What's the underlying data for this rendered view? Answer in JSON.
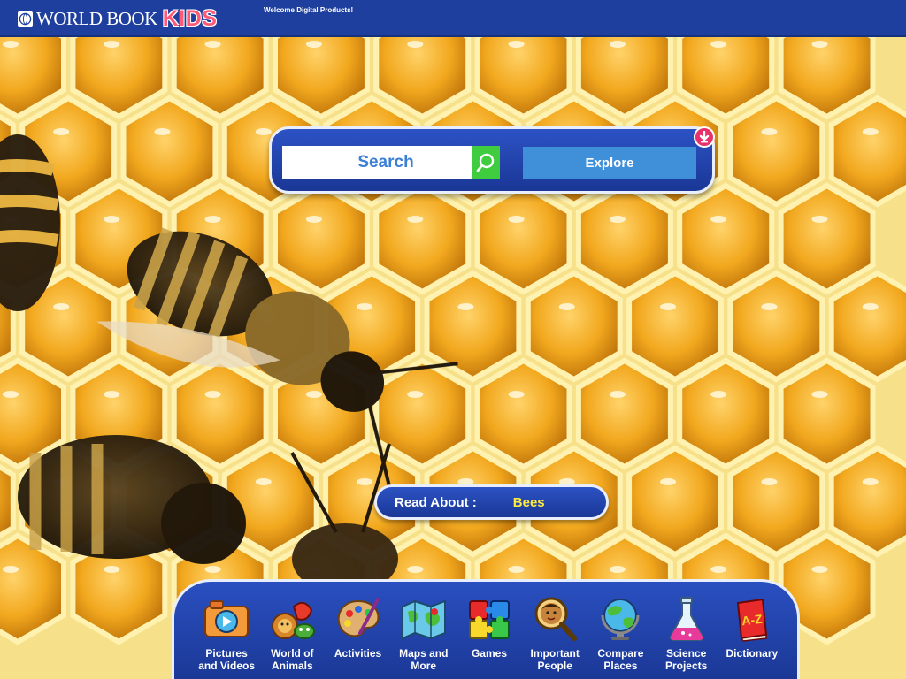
{
  "header": {
    "logo_text": "WORLD BOOK",
    "logo_kids": "KIDS",
    "welcome": "Welcome Digital Products!"
  },
  "search": {
    "placeholder": "Search",
    "explore_label": "Explore",
    "go_icon": "magnifier-icon",
    "explore_badge_icon": "arrow-down-icon"
  },
  "read_about": {
    "label": "Read About :",
    "topic": "Bees"
  },
  "tools": [
    {
      "label": "Pictures\nand Videos",
      "icon": "camera-icon"
    },
    {
      "label": "World of\nAnimals",
      "icon": "animals-icon"
    },
    {
      "label": "Activities",
      "icon": "paint-palette-icon"
    },
    {
      "label": "Maps and\nMore",
      "icon": "map-icon"
    },
    {
      "label": "Games",
      "icon": "puzzle-icon"
    },
    {
      "label": "Important\nPeople",
      "icon": "person-magnifier-icon"
    },
    {
      "label": "Compare\nPlaces",
      "icon": "globe-icon"
    },
    {
      "label": "Science\nProjects",
      "icon": "flask-icon"
    },
    {
      "label": "Dictionary",
      "icon": "book-az-icon"
    }
  ],
  "colors": {
    "header_bg": "#1f3f9e",
    "kids_pink": "#ff5a78",
    "panel_blue": "#1f44b0",
    "search_go_green": "#3fcd3f",
    "explore_blue": "#3f8fd9",
    "topic_yellow": "#ffeb3b",
    "honey": "#e0a020"
  }
}
